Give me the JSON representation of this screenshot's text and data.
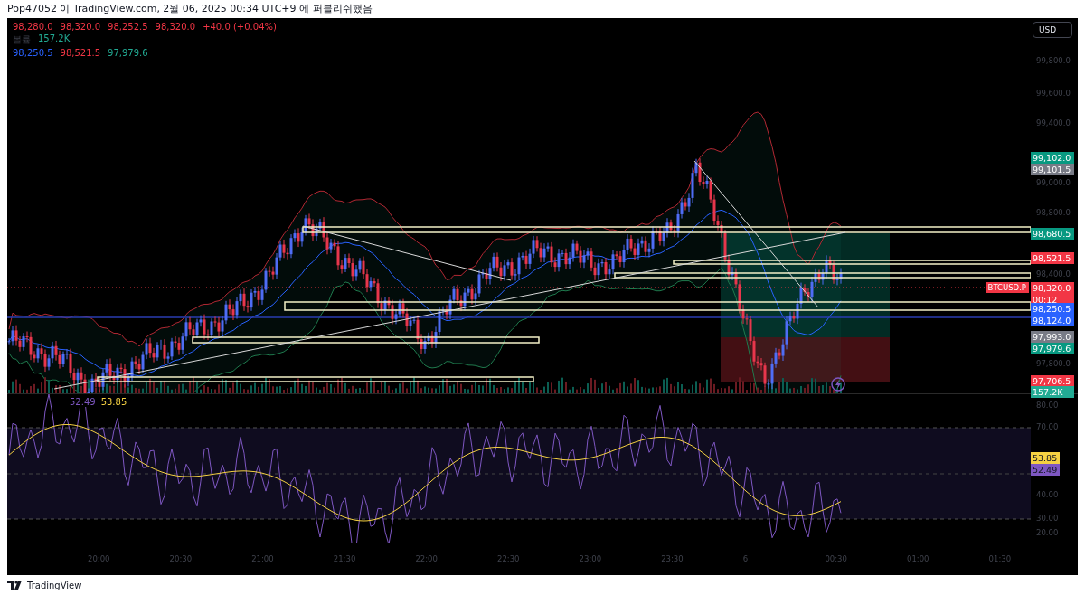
{
  "header": {
    "text": "Pop47052 이 TradingView.com, 2월 06, 2025 00:34 UTC+9 에 퍼블리쉬했음"
  },
  "legend": [
    {
      "items": [
        {
          "text": "98,280.0",
          "color": "#f23645"
        },
        {
          "text": "98,320.0",
          "color": "#f23645"
        },
        {
          "text": "98,252.5",
          "color": "#f23645"
        },
        {
          "text": "98,320.0",
          "color": "#f23645"
        },
        {
          "text": "+40.0 (+0.04%)",
          "color": "#f23645"
        }
      ]
    },
    {
      "items": [
        {
          "text": "볼륨",
          "color": "#3b3e48"
        },
        {
          "text": "157.2K",
          "color": "#22ab94"
        }
      ]
    },
    {
      "items": [
        {
          "text": "98,250.5",
          "color": "#2962ff"
        },
        {
          "text": "98,521.5",
          "color": "#f23645"
        },
        {
          "text": "97,979.6",
          "color": "#22ab94"
        }
      ]
    }
  ],
  "currency_button": {
    "label": "USD"
  },
  "price_axis": [
    "99,800.0",
    "99,600.0",
    "99,400.0",
    "99,000.0",
    "98,800.0",
    "98,400.0",
    "97,800.0"
  ],
  "price_tags": [
    {
      "text": "99,102.0",
      "color": "#089981"
    },
    {
      "text": "99,101.5",
      "color": "#787b86"
    },
    {
      "text": "98,680.5",
      "color": "#089981"
    },
    {
      "text": "98,521.5",
      "color": "#f23645"
    },
    {
      "text": "98,320.0",
      "sub": "00:12",
      "color": "#f23645"
    },
    {
      "text": "98,250.5",
      "color": "#2962ff"
    },
    {
      "text": "98,124.0",
      "color": "#2962ff"
    },
    {
      "text": "97,993.0",
      "color": "#787b86"
    },
    {
      "text": "97,979.6",
      "color": "#089981"
    },
    {
      "text": "97,706.5",
      "color": "#f23645"
    },
    {
      "text": "157.2K",
      "color": "#22ab94"
    }
  ],
  "symbol_tag": {
    "text": "BTCUSD.P"
  },
  "rsi_legend": [
    {
      "text": "52.49",
      "color": "#7e57c2"
    },
    {
      "text": "53.85",
      "color": "#f5d142"
    }
  ],
  "rsi_axis": [
    "80.00",
    "70.00",
    "40.00",
    "30.00",
    "20.00"
  ],
  "rsi_tags": [
    {
      "text": "53.85",
      "color": "#f5d142"
    },
    {
      "text": "52.49",
      "color": "#7e57c2"
    }
  ],
  "time_axis": [
    "20:00",
    "20:30",
    "21:00",
    "21:30",
    "22:00",
    "22:30",
    "23:00",
    "23:30",
    "6",
    "00:30",
    "01:00",
    "01:30"
  ],
  "footer": {
    "brand": "TradingView"
  }
}
